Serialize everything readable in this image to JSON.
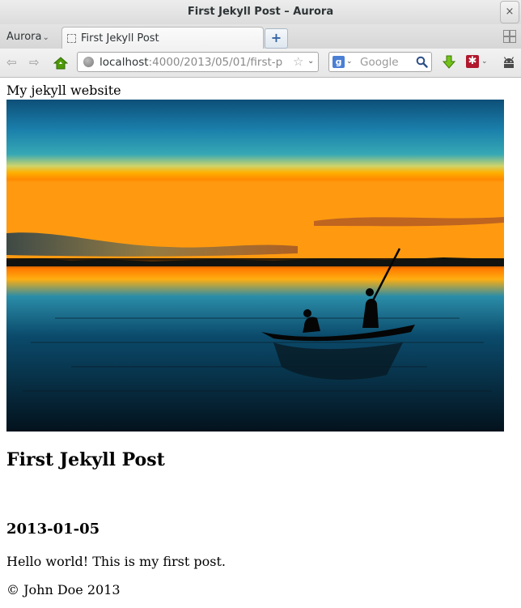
{
  "window": {
    "title": "First Jekyll Post – Aurora",
    "close_label": "×"
  },
  "tabstrip": {
    "app_menu_label": "Aurora",
    "chevron_glyph": "⌄",
    "tabs": [
      {
        "label": "First Jekyll Post",
        "active": true
      }
    ],
    "new_tab_label": "+"
  },
  "navbar": {
    "back_glyph": "⇦",
    "forward_glyph": "⇨",
    "url": {
      "host": "localhost",
      "rest": ":4000/2013/05/01/first-p"
    },
    "bookmark_glyph": "☆",
    "dropdown_glyph": "⌄",
    "search": {
      "engine_badge": "g",
      "placeholder": "Google"
    },
    "addon_badge": "✱"
  },
  "page": {
    "site_title": "My jekyll website",
    "post_title": "First Jekyll Post",
    "post_date": "2013-01-05",
    "post_body": "Hello world! This is my first post.",
    "footer": "© John Doe 2013"
  },
  "colors": {
    "accent": "#3465a4",
    "sky_top": "#0d5e89",
    "sunset": "#ff8a00",
    "water_dark": "#04141f",
    "addon": "#b0182d",
    "download": "#4e9a06"
  },
  "icons": [
    "back-icon",
    "forward-icon",
    "home-icon",
    "globe-icon",
    "bookmark-star-icon",
    "search-engine-icon",
    "magnifier-icon",
    "download-icon",
    "addon-icon",
    "android-icon",
    "tab-list-icon"
  ]
}
